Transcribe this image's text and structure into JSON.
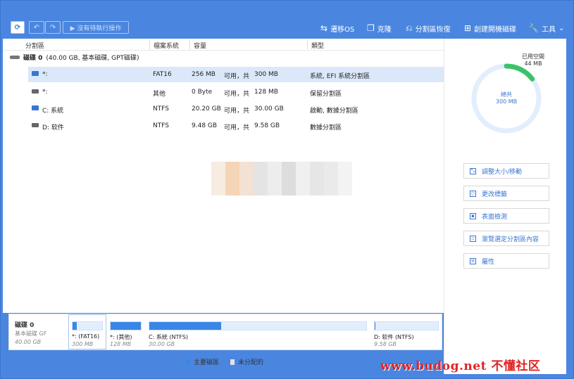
{
  "toolbar": {
    "refresh_icon": "refresh-icon",
    "undo_icon": "undo-icon",
    "redo_icon": "redo-icon",
    "pending_label": "▶ 沒有待執行操作",
    "tools": [
      {
        "label": "遷移OS",
        "icon": "migrate-icon"
      },
      {
        "label": "克隆",
        "icon": "clone-icon"
      },
      {
        "label": "分割區恢復",
        "icon": "recovery-icon"
      },
      {
        "label": "創建開機磁碟",
        "icon": "bootdisk-icon"
      },
      {
        "label": "工具",
        "icon": "wrench-icon"
      }
    ]
  },
  "columns": {
    "partition": "分割區",
    "fs": "檔案系統",
    "capacity": "容量",
    "type": "類型"
  },
  "disk": {
    "name": "磁碟 0",
    "details": "(40.00 GB, 基本磁碟, GPT磁碟)"
  },
  "partitions": [
    {
      "name": "*:",
      "fs": "FAT16",
      "used": "256 MB",
      "sep": "可用，共",
      "total": "300 MB",
      "type": "系統, EFI 系統分割區"
    },
    {
      "name": "*:",
      "fs": "其他",
      "used": "0 Byte",
      "sep": "可用，共",
      "total": "128 MB",
      "type": "保留分割區"
    },
    {
      "name": "C: 系統",
      "fs": "NTFS",
      "used": "20.20 GB",
      "sep": "可用，共",
      "total": "30.00 GB",
      "type": "啟動, 數據分割區"
    },
    {
      "name": "D: 软件",
      "fs": "NTFS",
      "used": "9.48 GB",
      "sep": "可用，共",
      "total": "9.58 GB",
      "type": "數據分割區"
    }
  ],
  "usage": {
    "used_label": "已用空間",
    "used_value": "44 MB",
    "total_label": "總共",
    "total_value": "300 MB",
    "used_fraction": 0.147
  },
  "operations": [
    "調整大小/移動",
    "更改標籤",
    "表面檢測",
    "瀏覽選定分割區內容",
    "屬性"
  ],
  "bottom_disk": {
    "name": "磁碟 0",
    "type": "基本磁碟 GF",
    "size": "40.00 GB"
  },
  "bottom_segments": [
    {
      "label": "*: (FAT16)",
      "size": "300 MB",
      "fill": 0.147
    },
    {
      "label": "*: (其他)",
      "size": "128 MB",
      "fill": 1.0
    },
    {
      "label": "C: 系統 (NTFS)",
      "size": "30.00 GB",
      "fill": 0.33
    },
    {
      "label": "D: 软件 (NTFS)",
      "size": "9.58 GB",
      "fill": 0.01
    }
  ],
  "legend": {
    "primary": "主要磁區",
    "unallocated": "未分配的"
  },
  "colors": {
    "accent": "#4a86e0",
    "primary": "#3a86e6",
    "usage_arc": "#3cc26a"
  },
  "watermark": "www.budog.net 不懂社区"
}
